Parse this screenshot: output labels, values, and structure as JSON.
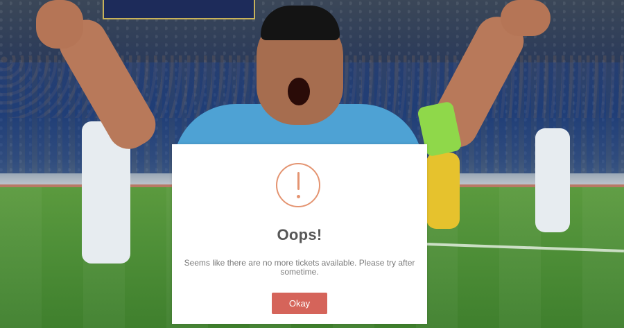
{
  "dialog": {
    "icon": "exclamation-circle-icon",
    "title": "Oops!",
    "message": "Seems like there are no more tickets available. Please try after sometime.",
    "ok_label": "Okay",
    "accent_color": "#e49471",
    "button_color": "#d5645a"
  }
}
